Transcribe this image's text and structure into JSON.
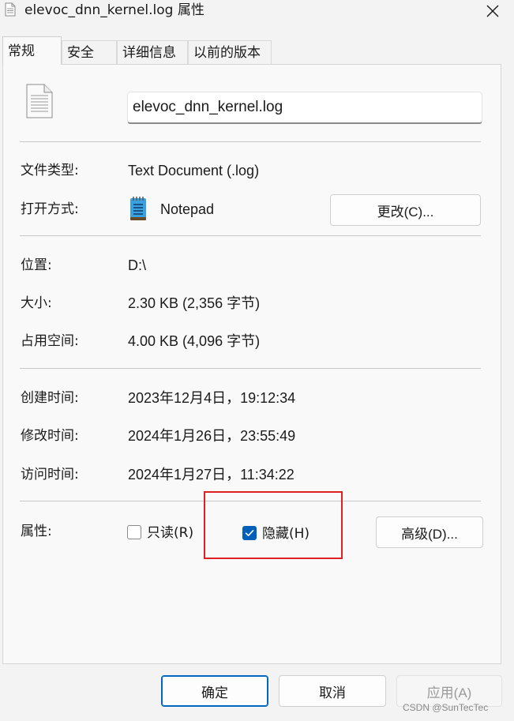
{
  "window": {
    "title": "elevoc_dnn_kernel.log 属性",
    "close_icon": "close-icon"
  },
  "tabs": [
    {
      "label": "常规",
      "active": true
    },
    {
      "label": "安全",
      "active": false
    },
    {
      "label": "详细信息",
      "active": false
    },
    {
      "label": "以前的版本",
      "active": false
    }
  ],
  "general": {
    "file_name": "elevoc_dnn_kernel.log",
    "file_type_label": "文件类型:",
    "file_type_value": "Text Document (.log)",
    "opens_with_label": "打开方式:",
    "opens_with_value": "Notepad",
    "change_button": "更改(C)...",
    "location_label": "位置:",
    "location_value": "D:\\",
    "size_label": "大小:",
    "size_value": "2.30 KB (2,356 字节)",
    "size_on_disk_label": "占用空间:",
    "size_on_disk_value": "4.00 KB (4,096 字节)",
    "created_label": "创建时间:",
    "created_value": "2023年12月4日，19:12:34",
    "modified_label": "修改时间:",
    "modified_value": "2024年1月26日，23:55:49",
    "accessed_label": "访问时间:",
    "accessed_value": "2024年1月27日，11:34:22",
    "attributes_label": "属性:",
    "readonly_label": "只读(R)",
    "readonly_checked": false,
    "hidden_label": "隐藏(H)",
    "hidden_checked": true,
    "advanced_button": "高级(D)..."
  },
  "footer": {
    "ok_button": "确定",
    "cancel_button": "取消",
    "apply_button": "应用(A)"
  },
  "watermark": "CSDN @SunTecTec",
  "colors": {
    "accent": "#005fb8",
    "highlight_box": "#e02020"
  }
}
